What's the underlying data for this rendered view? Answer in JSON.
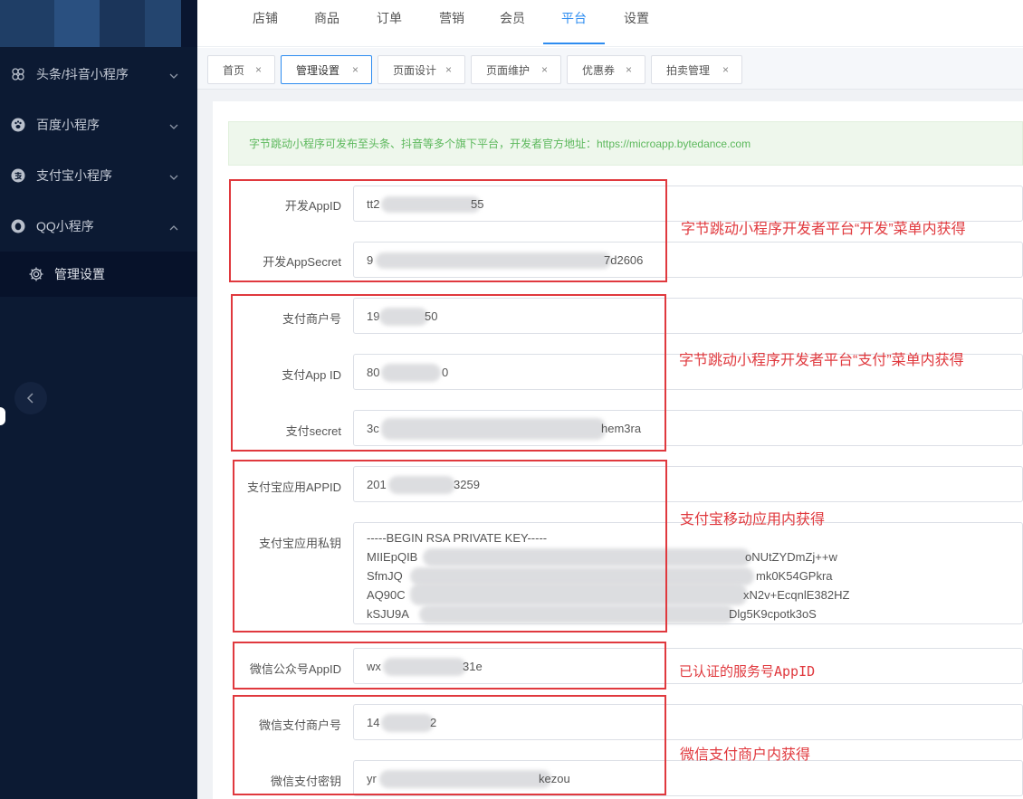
{
  "sidebar": {
    "items": [
      {
        "label": "头条/抖音小程序",
        "icon": "clover-icon",
        "arrow": "down"
      },
      {
        "label": "百度小程序",
        "icon": "paw-icon",
        "arrow": "down"
      },
      {
        "label": "支付宝小程序",
        "icon": "alipay-icon",
        "arrow": "down"
      },
      {
        "label": "QQ小程序",
        "icon": "qq-icon",
        "arrow": "up"
      }
    ],
    "submenu": {
      "label": "管理设置",
      "icon": "gear-icon"
    }
  },
  "topnav": {
    "items": [
      "店铺",
      "商品",
      "订单",
      "营销",
      "会员",
      "平台",
      "设置"
    ],
    "active": "平台"
  },
  "tabs": [
    {
      "label": "首页"
    },
    {
      "label": "管理设置"
    },
    {
      "label": "页面设计"
    },
    {
      "label": "页面维护"
    },
    {
      "label": "优惠券"
    },
    {
      "label": "拍卖管理"
    }
  ],
  "tab_close_glyph": "×",
  "notice": "字节跳动小程序可发布至头条、抖音等多个旗下平台，开发者官方地址：https://microapp.bytedance.com",
  "form": {
    "dev_appid": {
      "label": "开发AppID",
      "prefix": "tt2",
      "suffix": "55"
    },
    "dev_secret": {
      "label": "开发AppSecret",
      "prefix": "9",
      "suffix": "7d2606"
    },
    "pay_merchant": {
      "label": "支付商户号",
      "prefix": "19",
      "suffix": "50"
    },
    "pay_appid": {
      "label": "支付App ID",
      "prefix": "80",
      "suffix": "0"
    },
    "pay_secret": {
      "label": "支付secret",
      "prefix": "3c",
      "suffix": "hem3ra"
    },
    "alipay_appid": {
      "label": "支付宝应用APPID",
      "prefix": "201",
      "suffix": "3259"
    },
    "alipay_key": {
      "label": "支付宝应用私钥",
      "lines": [
        {
          "prefix": "-----BEGIN RSA PRIVATE KEY-----",
          "suffix": ""
        },
        {
          "prefix": "MIIEpQIB",
          "suffix": "oNUtZYDmZj++w"
        },
        {
          "prefix": "SfmJQ",
          "suffix": "mk0K54GPkra"
        },
        {
          "prefix": "AQ90C",
          "suffix": "xN2v+EcqnlE382HZ"
        },
        {
          "prefix": "kSJU9A",
          "suffix": "Dlg5K9cpotk3oS"
        }
      ]
    },
    "wechat_appid": {
      "label": "微信公众号AppID",
      "prefix": "wx",
      "suffix": "31e"
    },
    "wechat_merchant": {
      "label": "微信支付商户号",
      "prefix": "14",
      "suffix": "2"
    },
    "wechat_key": {
      "label": "微信支付密钥",
      "prefix": "yr",
      "suffix": "kezou"
    }
  },
  "annotations": {
    "dev": "字节跳动小程序开发者平台“开发”菜单内获得",
    "pay": "字节跳动小程序开发者平台“支付”菜单内获得",
    "alipay": "支付宝移动应用内获得",
    "wechat_appid": "已认证的服务号AppID",
    "wechat_pay": "微信支付商户内获得"
  },
  "colors": {
    "sidebar_bg": "#0c1a33",
    "accent": "#2d8cf0",
    "annotation_red": "#e0393e",
    "notice_text": "#5cb85c"
  }
}
